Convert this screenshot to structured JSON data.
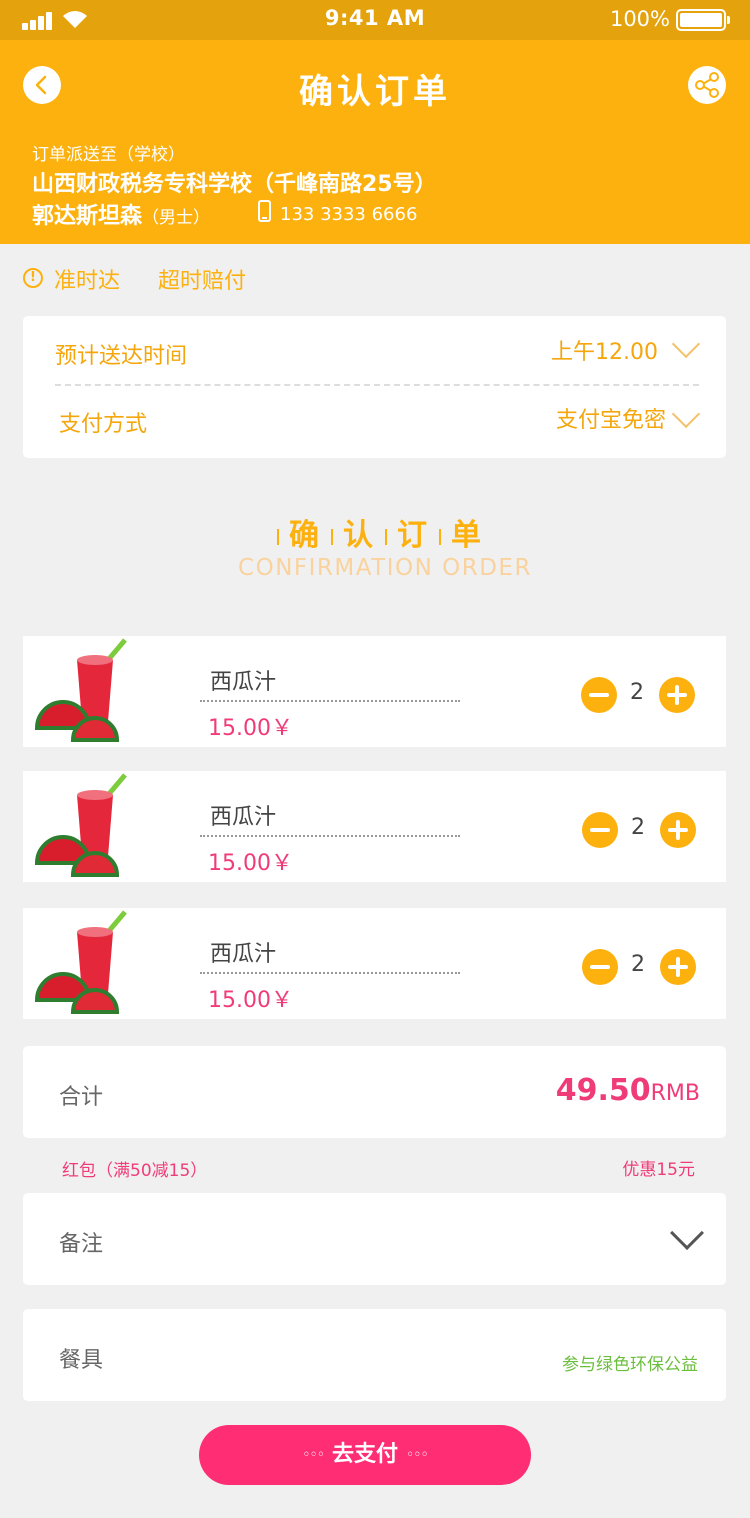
{
  "status_bar": {
    "time": "9:41 AM",
    "battery": "100%"
  },
  "header": {
    "title": "确认订单",
    "deliver_label": "订单派送至（学校）",
    "school": "山西财政税务专科学校（千峰南路25号）",
    "receiver_name": "郭达斯坦森",
    "receiver_gender": "（男士）",
    "phone": "133 3333 6666"
  },
  "guarantee": {
    "icon": "!",
    "ontime": "准时达",
    "overtime": "超时赔付"
  },
  "delivery": {
    "time_label": "预计送达时间",
    "time_value": "上午12.00",
    "pay_label": "支付方式",
    "pay_value": "支付宝免密"
  },
  "section": {
    "title_chars": [
      "确",
      "认",
      "订",
      "单"
    ],
    "subtitle": "CONFIRMATION  ORDER"
  },
  "items": [
    {
      "name": "西瓜汁",
      "price": "15.00￥",
      "qty": "2"
    },
    {
      "name": "西瓜汁",
      "price": "15.00￥",
      "qty": "2"
    },
    {
      "name": "西瓜汁",
      "price": "15.00￥",
      "qty": "2"
    }
  ],
  "total": {
    "label": "合计",
    "value": "49.50",
    "unit": "RMB"
  },
  "promo": {
    "redpack": "红包（满50减15）",
    "discount": "优惠15元"
  },
  "note": {
    "label": "备注"
  },
  "tableware": {
    "label": "餐具",
    "eco": "参与绿色环保公益"
  },
  "pay_button": {
    "label": "去支付",
    "dots": "◦◦◦"
  },
  "colors": {
    "brand": "#fcb10f",
    "status_bar": "#e4a20d",
    "accent_pink": "#ef3c78",
    "pay_button": "#ff2d73",
    "eco_green": "#6bbf3e"
  }
}
